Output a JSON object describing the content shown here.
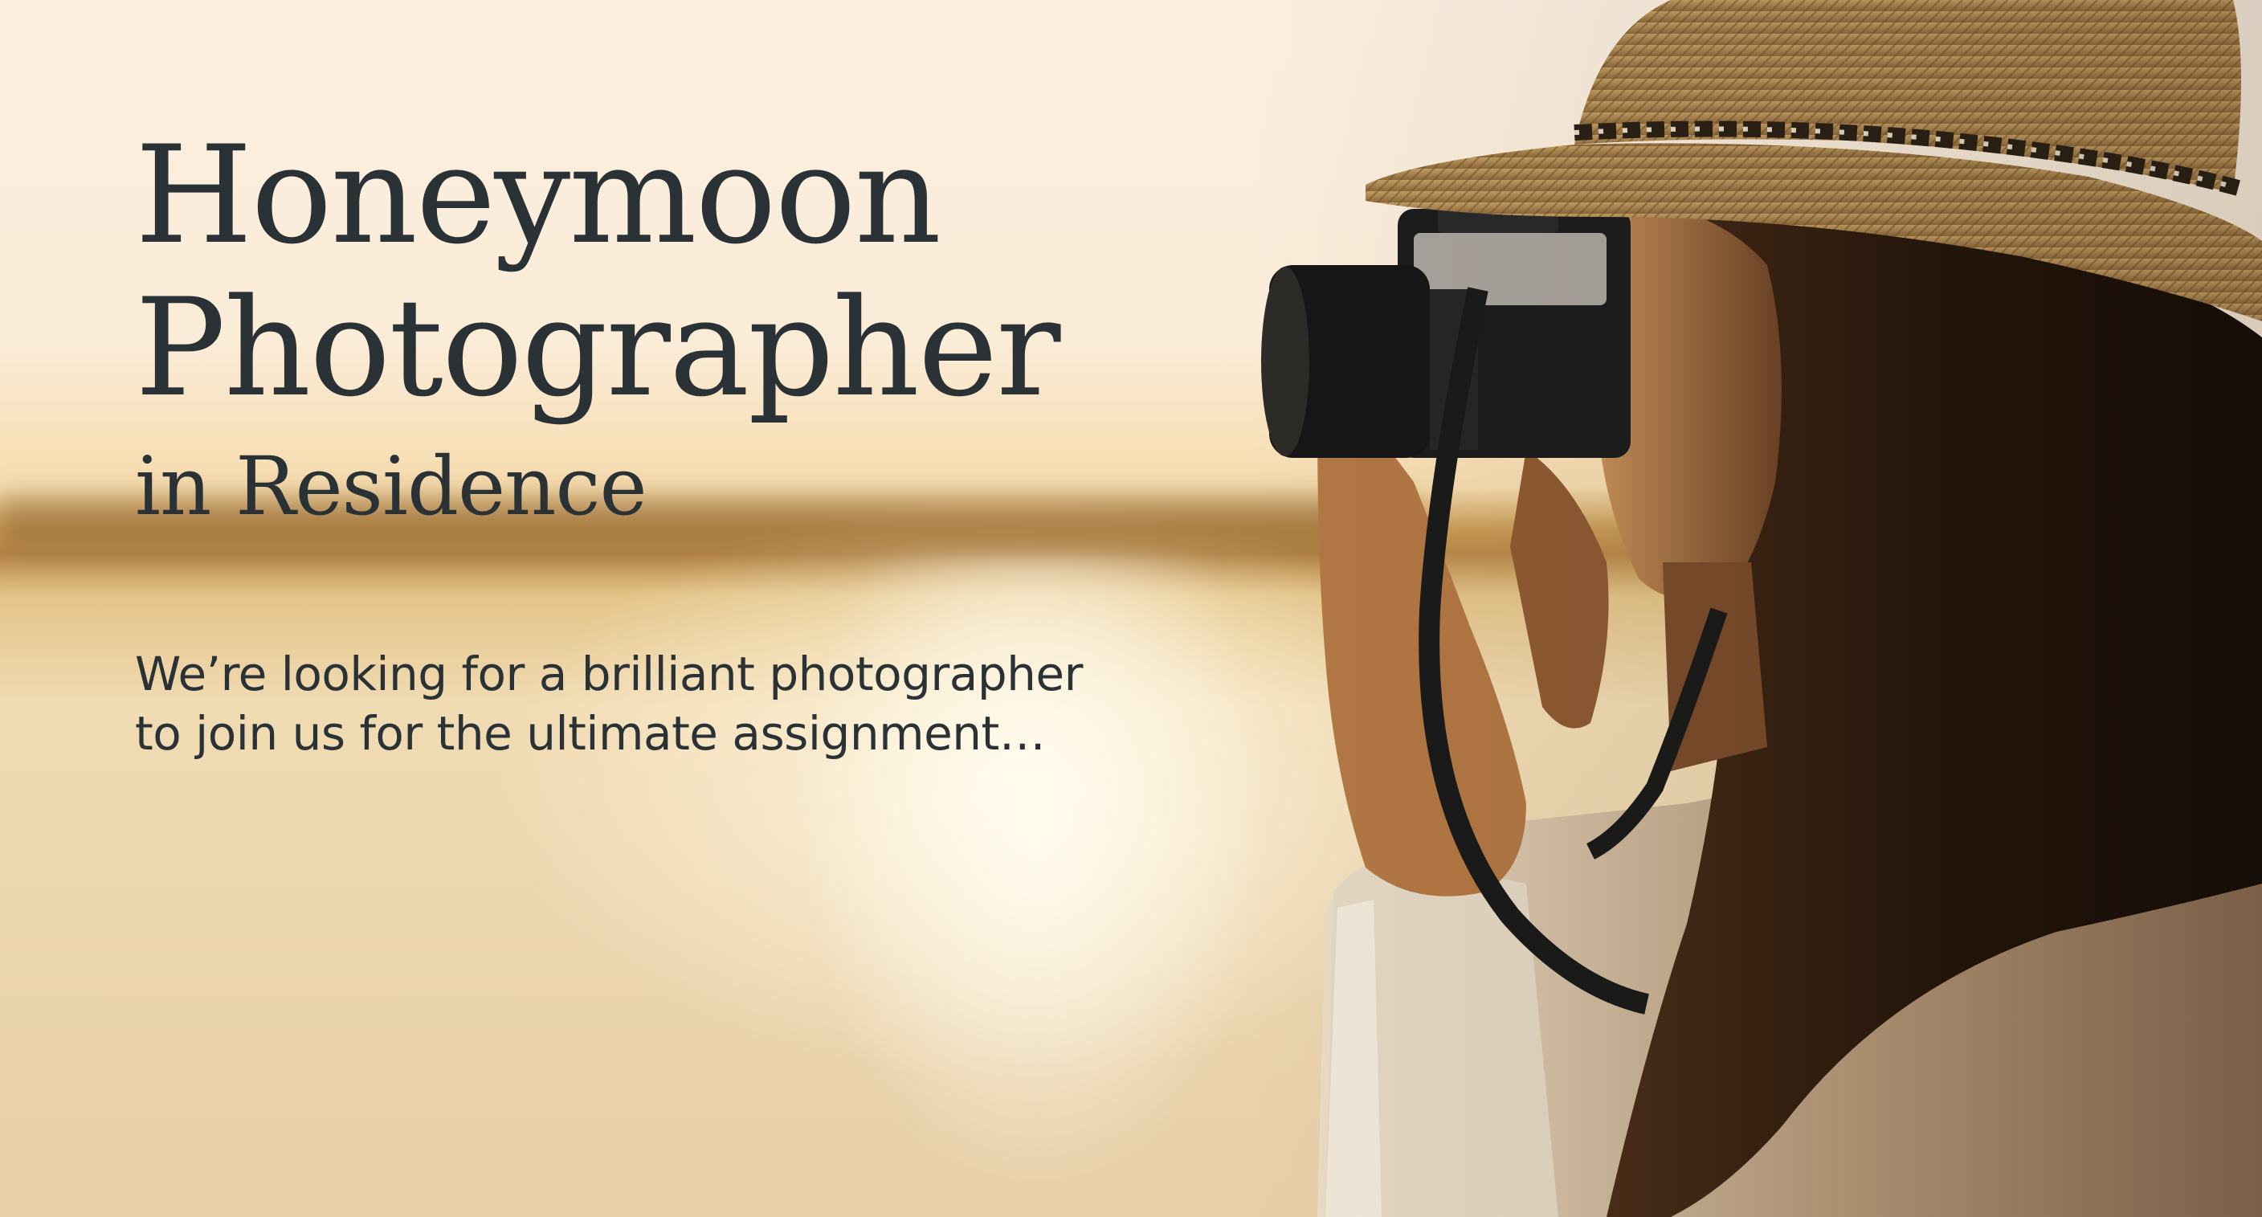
{
  "headline": {
    "line1": "Honeymoon",
    "line2": "Photographer",
    "line3": "in Residence"
  },
  "intro": {
    "line1": "We’re looking for a brilliant photographer",
    "line2": "to join us for the ultimate assignment…"
  },
  "photo": {
    "subject": "woman in straw hat taking a photo with a film camera at sunset"
  },
  "colors": {
    "text": "#2a3236",
    "sky": "#fbefe0",
    "hat": "#b8925a",
    "shadow": "#2a1b10"
  }
}
